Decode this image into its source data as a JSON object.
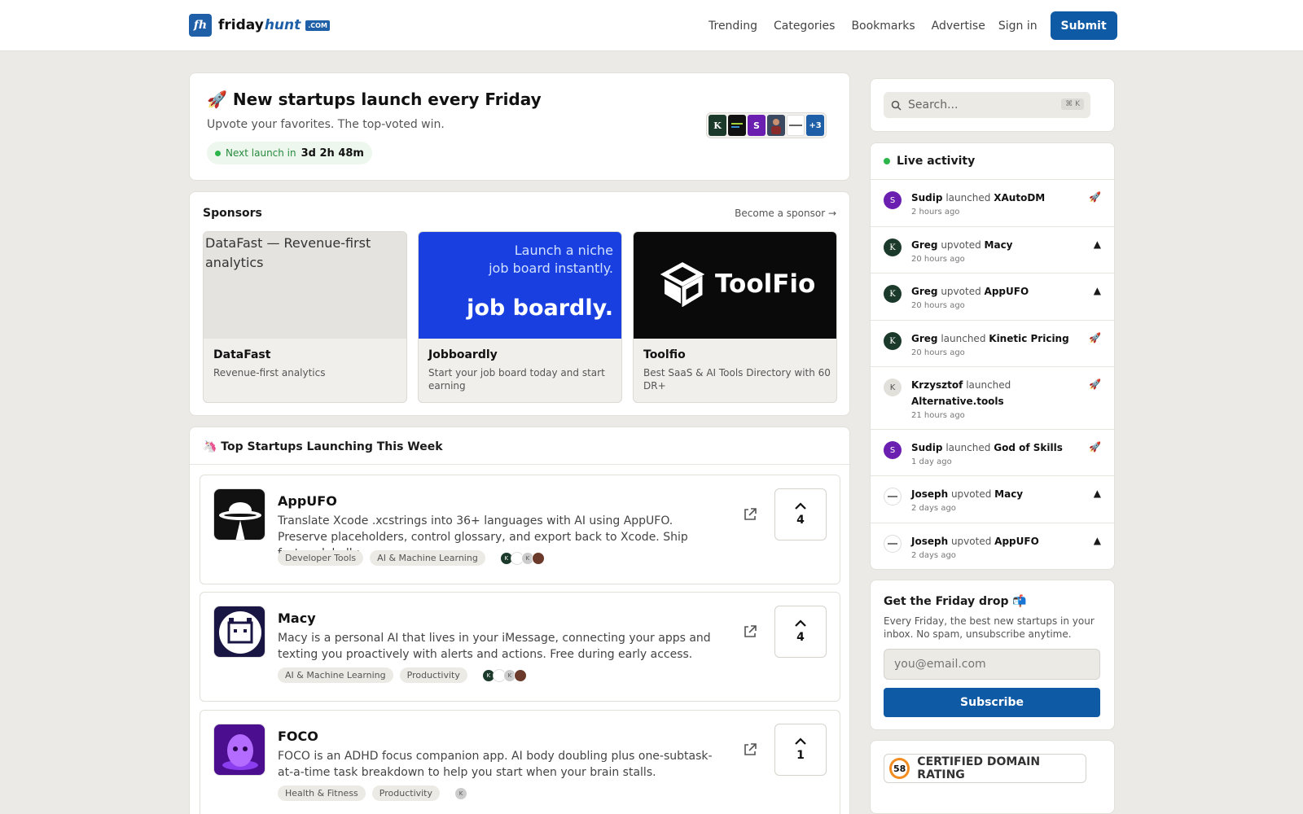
{
  "header": {
    "logo_mark": "fh",
    "logo_word1": "friday",
    "logo_word2": "hunt",
    "logo_suffix": ".COM",
    "nav": [
      "Trending",
      "Categories",
      "Bookmarks",
      "Advertise"
    ],
    "signin": "Sign in",
    "submit": "Submit"
  },
  "hero": {
    "title": "🚀 New startups launch every Friday",
    "subtitle": "Upvote your favorites. The top-voted win.",
    "next_label": "Next launch in",
    "next_time": "3d 2h 48m",
    "avatars_more": "+3",
    "avatar_letters": [
      "K",
      "",
      "S",
      "",
      "",
      ""
    ]
  },
  "sponsors": {
    "heading": "Sponsors",
    "become": "Become a sponsor →",
    "items": [
      {
        "name": "DataFast",
        "desc": "Revenue-first analytics",
        "alt": "DataFast — Revenue-first analytics"
      },
      {
        "name": "Jobboardly",
        "desc": "Start your job board today and start earning",
        "banner_line1": "Launch a niche",
        "banner_line2": "job board instantly.",
        "banner_brand": "job boardly."
      },
      {
        "name": "Toolfio",
        "desc": "Best SaaS & AI Tools Directory with 60 DR+",
        "banner_brand": "ToolFio"
      }
    ]
  },
  "startups": {
    "heading": "🦄 Top Startups Launching This Week",
    "items": [
      {
        "name": "AppUFO",
        "desc": "Translate Xcode .xcstrings into 36+ languages with AI using AppUFO. Preserve placeholders, control glossary, and export back to Xcode. Ship faster globally.",
        "tags": [
          "Developer Tools",
          "AI & Machine Learning"
        ],
        "votes": "4"
      },
      {
        "name": "Macy",
        "desc": "Macy is a personal AI that lives in your iMessage, connecting your apps and texting you proactively with alerts and actions. Free during early access.",
        "tags": [
          "AI & Machine Learning",
          "Productivity"
        ],
        "votes": "4"
      },
      {
        "name": "FOCO",
        "desc": "FOCO is an ADHD focus companion app. AI body doubling plus one-subtask-at-a-time task breakdown to help you start when your brain stalls.",
        "tags": [
          "Health & Fitness",
          "Productivity"
        ],
        "votes": "1"
      }
    ]
  },
  "search": {
    "placeholder": "Search...",
    "shortcut": "⌘ K"
  },
  "activity": {
    "heading": "Live activity",
    "items": [
      {
        "user": "Sudip",
        "action": "launched",
        "target": "XAutoDM",
        "time": "2 hours ago",
        "avatar": "S"
      },
      {
        "user": "Greg",
        "action": "upvoted",
        "target": "Macy",
        "time": "20 hours ago",
        "avatar": "K"
      },
      {
        "user": "Greg",
        "action": "upvoted",
        "target": "AppUFO",
        "time": "20 hours ago",
        "avatar": "K"
      },
      {
        "user": "Greg",
        "action": "launched",
        "target": "Kinetic Pricing",
        "time": "20 hours ago",
        "avatar": "K"
      },
      {
        "user": "Krzysztof",
        "action": "launched",
        "target": "Alternative.tools",
        "time": "21 hours ago",
        "avatar": "K"
      },
      {
        "user": "Sudip",
        "action": "launched",
        "target": "God of Skills",
        "time": "1 day ago",
        "avatar": "S"
      },
      {
        "user": "Joseph",
        "action": "upvoted",
        "target": "Macy",
        "time": "2 days ago",
        "avatar": ""
      },
      {
        "user": "Joseph",
        "action": "upvoted",
        "target": "AppUFO",
        "time": "2 days ago",
        "avatar": ""
      }
    ]
  },
  "newsletter": {
    "title": "Get the Friday drop 📬",
    "desc": "Every Friday, the best new startups in your inbox. No spam, unsubscribe anytime.",
    "placeholder": "you@email.com",
    "button": "Subscribe"
  },
  "rating": {
    "value": "58",
    "label": "CERTIFIED DOMAIN RATING"
  },
  "colors": {
    "accent": "#0f5aa5",
    "live": "#2bb54a",
    "rating_ring": "#f28c1e"
  }
}
